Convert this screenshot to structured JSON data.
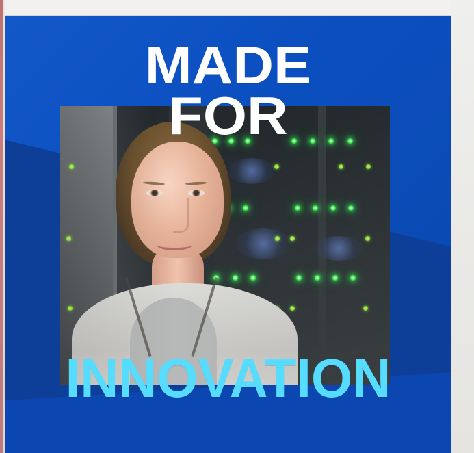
{
  "ad": {
    "headline_line_1": "MADE",
    "headline_line_2": "FOR",
    "headline_line_3": "INNOVATION",
    "colors": {
      "background_blue": "#0d52c4",
      "dark_blue": "#0d3f98",
      "headline_white": "#ffffff",
      "headline_cyan": "#55dcff",
      "server_led_green": "#4dff5f"
    },
    "image": {
      "icon": "person-photo"
    }
  }
}
